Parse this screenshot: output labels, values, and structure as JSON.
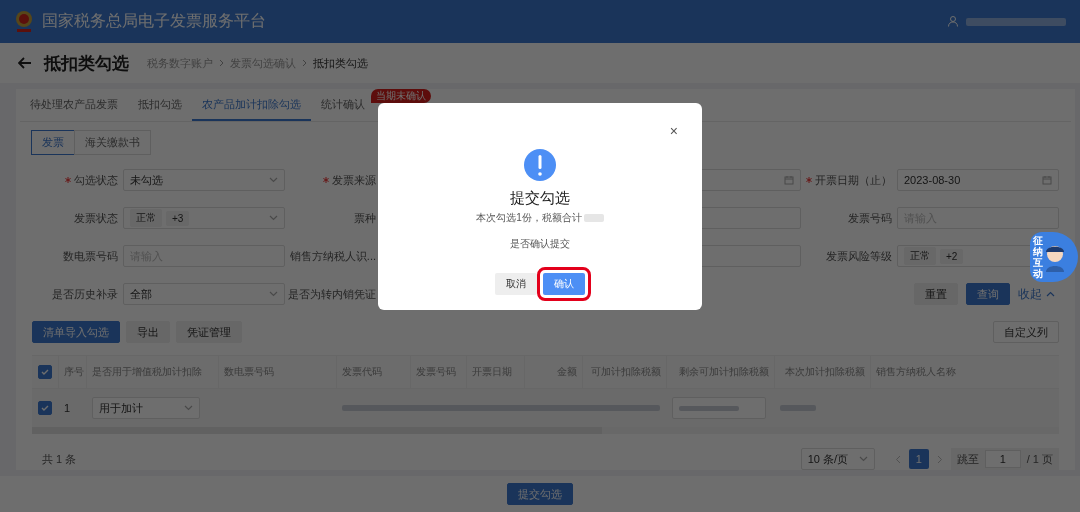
{
  "header": {
    "title": "国家税务总局电子发票服务平台"
  },
  "page": {
    "title": "抵扣类勾选",
    "breadcrumb": [
      {
        "label": "税务数字账户",
        "current": false
      },
      {
        "label": "发票勾选确认",
        "current": false
      },
      {
        "label": "抵扣类勾选",
        "current": true
      }
    ]
  },
  "tabs": [
    {
      "label": "待处理农产品发票",
      "selected": false
    },
    {
      "label": "抵扣勾选",
      "selected": false
    },
    {
      "label": "农产品加计扣除勾选",
      "selected": true
    },
    {
      "label": "统计确认",
      "selected": false,
      "badge": "当期未确认"
    }
  ],
  "doc_types": [
    {
      "label": "发票",
      "selected": true
    },
    {
      "label": "海关缴款书",
      "selected": false
    }
  ],
  "filters": [
    {
      "label": "勾选状态",
      "required": true,
      "kind": "select",
      "value": "未勾选"
    },
    {
      "label": "发票来源",
      "required": true,
      "kind": "select"
    },
    {
      "kind": "date"
    },
    {
      "label": "开票日期（止）",
      "required": true,
      "kind": "date",
      "value": "2023-08-30"
    },
    {
      "label": "发票状态",
      "required": false,
      "kind": "tags",
      "tags": [
        "正常",
        "+3"
      ]
    },
    {
      "label": "票种",
      "required": false,
      "kind": "select"
    },
    {
      "kind": "input"
    },
    {
      "label": "发票号码",
      "required": false,
      "kind": "input",
      "placeholder": "请输入"
    },
    {
      "label": "数电票号码",
      "required": false,
      "kind": "input",
      "placeholder": "请输入"
    },
    {
      "label": "销售方纳税人识...",
      "required": false,
      "kind": "input"
    },
    {
      "kind": "input"
    },
    {
      "label": "发票风险等级",
      "required": false,
      "kind": "tags",
      "tags": [
        "正常",
        "+2"
      ]
    },
    {
      "label": "是否历史补录",
      "required": false,
      "kind": "select",
      "value": "全部"
    },
    {
      "label": "是否为转内销凭证",
      "required": false,
      "kind": "select"
    }
  ],
  "filter_actions": {
    "reset": "重置",
    "search": "查询",
    "collapse": "收起"
  },
  "toolbar": {
    "buttons": [
      {
        "label": "清单导入勾选",
        "primary": true
      },
      {
        "label": "导出",
        "primary": false
      },
      {
        "label": "凭证管理",
        "primary": false
      }
    ],
    "customize": "自定义列"
  },
  "table": {
    "all_checked": true,
    "columns": [
      {
        "label": "序号",
        "numeric": false
      },
      {
        "label": "是否用于增值税加计扣除",
        "numeric": false
      },
      {
        "label": "数电票号码",
        "numeric": false
      },
      {
        "label": "发票代码",
        "numeric": false
      },
      {
        "label": "发票号码",
        "numeric": false
      },
      {
        "label": "开票日期",
        "numeric": false
      },
      {
        "label": "金额",
        "numeric": true
      },
      {
        "label": "可加计扣除税额",
        "numeric": true
      },
      {
        "label": "剩余可加计扣除税额",
        "numeric": true
      },
      {
        "label": "本次加计扣除税额",
        "numeric": true
      },
      {
        "label": "销售方纳税人名称",
        "numeric": false
      }
    ],
    "rows": [
      {
        "checked": true,
        "index": "1",
        "usage": "用于加计"
      }
    ]
  },
  "pagination": {
    "total": "共 1 条",
    "page_size": "10 条/页",
    "pages": [
      {
        "label": "1",
        "selected": true
      }
    ],
    "jump_label": "跳至",
    "jump_value": "1",
    "page_count": "/ 1 页"
  },
  "submit": "提交勾选",
  "chat_widget": {
    "label": "征纳互动"
  },
  "dialog": {
    "title": "提交勾选",
    "message": "本次勾选1份，税额合计",
    "question": "是否确认提交",
    "close": "×",
    "buttons": [
      {
        "label": "取消",
        "primary": false,
        "highlighted": false
      },
      {
        "label": "确认",
        "primary": true,
        "highlighted": true
      }
    ]
  }
}
